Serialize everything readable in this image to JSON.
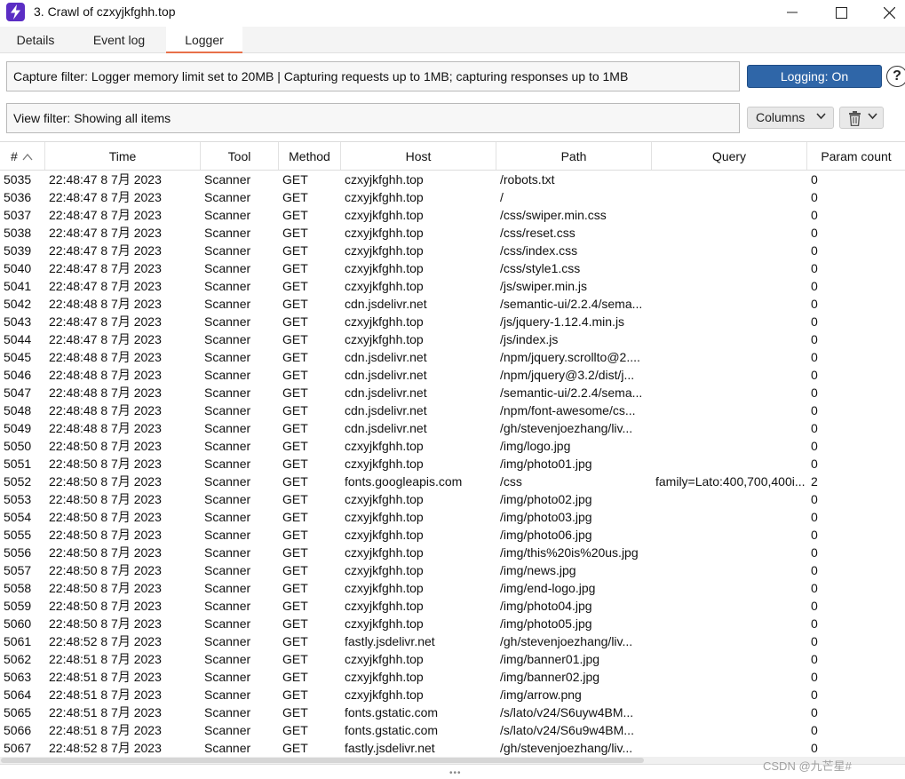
{
  "window": {
    "title": "3. Crawl of czxyjkfghh.top",
    "app_icon": "burp-lightning-icon",
    "accent": "#5b2dc4"
  },
  "tabs": [
    {
      "label": "Details"
    },
    {
      "label": "Event log"
    },
    {
      "label": "Logger",
      "active": true
    }
  ],
  "capture_filter": {
    "text": "Capture filter: Logger memory limit set to 20MB | Capturing requests up to 1MB;  capturing responses up to 1MB"
  },
  "logging_button": {
    "label": "Logging: On",
    "color": "#2f66a8"
  },
  "view_filter": {
    "text": "View filter: Showing all items"
  },
  "columns_button": {
    "label": "Columns"
  },
  "table": {
    "headers": [
      "#",
      "Time",
      "Tool",
      "Method",
      "Host",
      "Path",
      "Query",
      "Param count"
    ],
    "sort_column": "#",
    "rows": [
      [
        "5035",
        "22:48:47 8 7月 2023",
        "Scanner",
        "GET",
        "czxyjkfghh.top",
        "/robots.txt",
        "",
        "0"
      ],
      [
        "5036",
        "22:48:47 8 7月 2023",
        "Scanner",
        "GET",
        "czxyjkfghh.top",
        "/",
        "",
        "0"
      ],
      [
        "5037",
        "22:48:47 8 7月 2023",
        "Scanner",
        "GET",
        "czxyjkfghh.top",
        "/css/swiper.min.css",
        "",
        "0"
      ],
      [
        "5038",
        "22:48:47 8 7月 2023",
        "Scanner",
        "GET",
        "czxyjkfghh.top",
        "/css/reset.css",
        "",
        "0"
      ],
      [
        "5039",
        "22:48:47 8 7月 2023",
        "Scanner",
        "GET",
        "czxyjkfghh.top",
        "/css/index.css",
        "",
        "0"
      ],
      [
        "5040",
        "22:48:47 8 7月 2023",
        "Scanner",
        "GET",
        "czxyjkfghh.top",
        "/css/style1.css",
        "",
        "0"
      ],
      [
        "5041",
        "22:48:47 8 7月 2023",
        "Scanner",
        "GET",
        "czxyjkfghh.top",
        "/js/swiper.min.js",
        "",
        "0"
      ],
      [
        "5042",
        "22:48:48 8 7月 2023",
        "Scanner",
        "GET",
        "cdn.jsdelivr.net",
        "/semantic-ui/2.2.4/sema...",
        "",
        "0"
      ],
      [
        "5043",
        "22:48:47 8 7月 2023",
        "Scanner",
        "GET",
        "czxyjkfghh.top",
        "/js/jquery-1.12.4.min.js",
        "",
        "0"
      ],
      [
        "5044",
        "22:48:47 8 7月 2023",
        "Scanner",
        "GET",
        "czxyjkfghh.top",
        "/js/index.js",
        "",
        "0"
      ],
      [
        "5045",
        "22:48:48 8 7月 2023",
        "Scanner",
        "GET",
        "cdn.jsdelivr.net",
        "/npm/jquery.scrollto@2....",
        "",
        "0"
      ],
      [
        "5046",
        "22:48:48 8 7月 2023",
        "Scanner",
        "GET",
        "cdn.jsdelivr.net",
        "/npm/jquery@3.2/dist/j...",
        "",
        "0"
      ],
      [
        "5047",
        "22:48:48 8 7月 2023",
        "Scanner",
        "GET",
        "cdn.jsdelivr.net",
        "/semantic-ui/2.2.4/sema...",
        "",
        "0"
      ],
      [
        "5048",
        "22:48:48 8 7月 2023",
        "Scanner",
        "GET",
        "cdn.jsdelivr.net",
        "/npm/font-awesome/cs...",
        "",
        "0"
      ],
      [
        "5049",
        "22:48:48 8 7月 2023",
        "Scanner",
        "GET",
        "cdn.jsdelivr.net",
        "/gh/stevenjoezhang/liv...",
        "",
        "0"
      ],
      [
        "5050",
        "22:48:50 8 7月 2023",
        "Scanner",
        "GET",
        "czxyjkfghh.top",
        "/img/logo.jpg",
        "",
        "0"
      ],
      [
        "5051",
        "22:48:50 8 7月 2023",
        "Scanner",
        "GET",
        "czxyjkfghh.top",
        "/img/photo01.jpg",
        "",
        "0"
      ],
      [
        "5052",
        "22:48:50 8 7月 2023",
        "Scanner",
        "GET",
        "fonts.googleapis.com",
        "/css",
        "family=Lato:400,700,400i...",
        "2"
      ],
      [
        "5053",
        "22:48:50 8 7月 2023",
        "Scanner",
        "GET",
        "czxyjkfghh.top",
        "/img/photo02.jpg",
        "",
        "0"
      ],
      [
        "5054",
        "22:48:50 8 7月 2023",
        "Scanner",
        "GET",
        "czxyjkfghh.top",
        "/img/photo03.jpg",
        "",
        "0"
      ],
      [
        "5055",
        "22:48:50 8 7月 2023",
        "Scanner",
        "GET",
        "czxyjkfghh.top",
        "/img/photo06.jpg",
        "",
        "0"
      ],
      [
        "5056",
        "22:48:50 8 7月 2023",
        "Scanner",
        "GET",
        "czxyjkfghh.top",
        "/img/this%20is%20us.jpg",
        "",
        "0"
      ],
      [
        "5057",
        "22:48:50 8 7月 2023",
        "Scanner",
        "GET",
        "czxyjkfghh.top",
        "/img/news.jpg",
        "",
        "0"
      ],
      [
        "5058",
        "22:48:50 8 7月 2023",
        "Scanner",
        "GET",
        "czxyjkfghh.top",
        "/img/end-logo.jpg",
        "",
        "0"
      ],
      [
        "5059",
        "22:48:50 8 7月 2023",
        "Scanner",
        "GET",
        "czxyjkfghh.top",
        "/img/photo04.jpg",
        "",
        "0"
      ],
      [
        "5060",
        "22:48:50 8 7月 2023",
        "Scanner",
        "GET",
        "czxyjkfghh.top",
        "/img/photo05.jpg",
        "",
        "0"
      ],
      [
        "5061",
        "22:48:52 8 7月 2023",
        "Scanner",
        "GET",
        "fastly.jsdelivr.net",
        "/gh/stevenjoezhang/liv...",
        "",
        "0"
      ],
      [
        "5062",
        "22:48:51 8 7月 2023",
        "Scanner",
        "GET",
        "czxyjkfghh.top",
        "/img/banner01.jpg",
        "",
        "0"
      ],
      [
        "5063",
        "22:48:51 8 7月 2023",
        "Scanner",
        "GET",
        "czxyjkfghh.top",
        "/img/banner02.jpg",
        "",
        "0"
      ],
      [
        "5064",
        "22:48:51 8 7月 2023",
        "Scanner",
        "GET",
        "czxyjkfghh.top",
        "/img/arrow.png",
        "",
        "0"
      ],
      [
        "5065",
        "22:48:51 8 7月 2023",
        "Scanner",
        "GET",
        "fonts.gstatic.com",
        "/s/lato/v24/S6uyw4BM...",
        "",
        "0"
      ],
      [
        "5066",
        "22:48:51 8 7月 2023",
        "Scanner",
        "GET",
        "fonts.gstatic.com",
        "/s/lato/v24/S6u9w4BM...",
        "",
        "0"
      ],
      [
        "5067",
        "22:48:52 8 7月 2023",
        "Scanner",
        "GET",
        "fastly.jsdelivr.net",
        "/gh/stevenjoezhang/liv...",
        "",
        "0"
      ]
    ]
  },
  "watermark": "CSDN @九芒星#"
}
